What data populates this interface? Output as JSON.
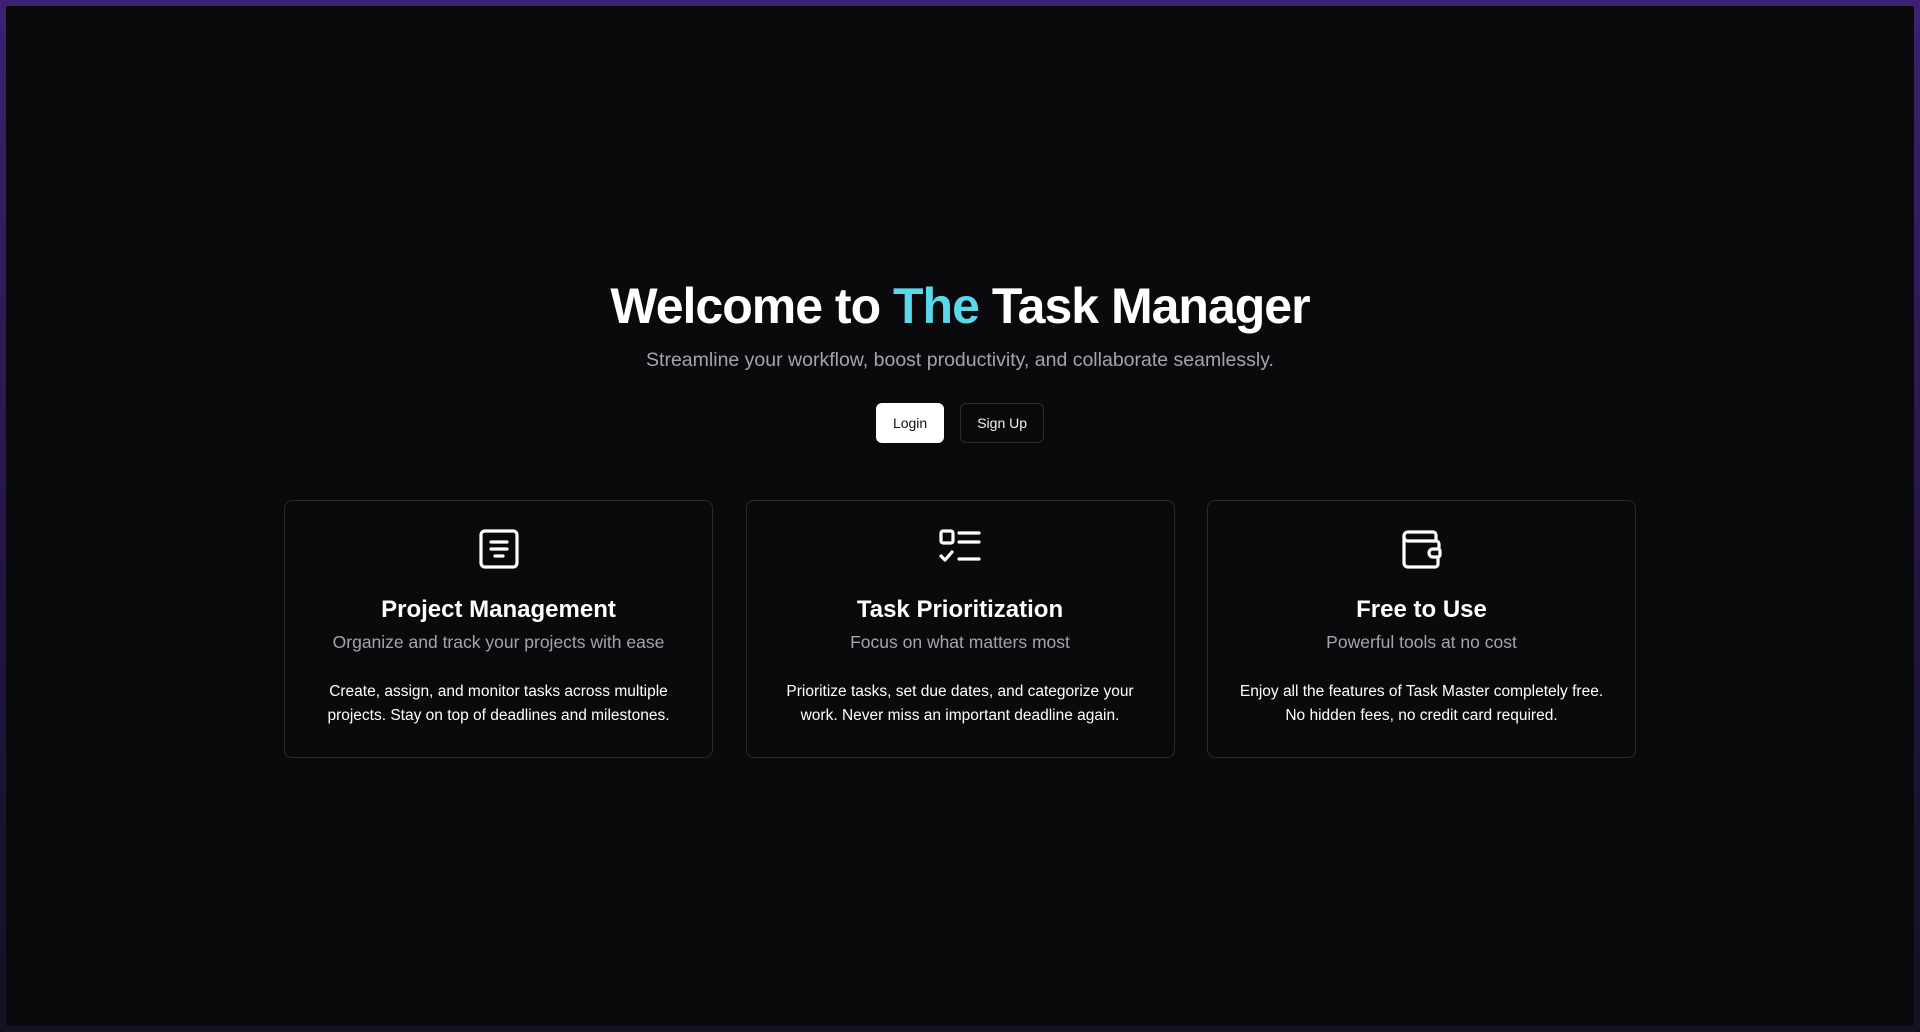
{
  "hero": {
    "title_prefix": "Welcome to ",
    "title_accent": "The",
    "title_suffix": " Task Manager",
    "subtitle": "Streamline your workflow, boost productivity, and collaborate seamlessly.",
    "login_label": "Login",
    "signup_label": "Sign Up"
  },
  "features": [
    {
      "icon": "document-list-icon",
      "title": "Project Management",
      "subtitle": "Organize and track your projects with ease",
      "description": "Create, assign, and monitor tasks across multiple projects. Stay on top of deadlines and milestones."
    },
    {
      "icon": "checklist-icon",
      "title": "Task Prioritization",
      "subtitle": "Focus on what matters most",
      "description": "Prioritize tasks, set due dates, and categorize your work. Never miss an important deadline again."
    },
    {
      "icon": "wallet-icon",
      "title": "Free to Use",
      "subtitle": "Powerful tools at no cost",
      "description": "Enjoy all the features of Task Master completely free. No hidden fees, no credit card required."
    }
  ],
  "colors": {
    "accent": "#5ad8ea",
    "background": "#0a0a0d",
    "muted_text": "#a4a4aa",
    "card_border": "#2a2a2e"
  }
}
